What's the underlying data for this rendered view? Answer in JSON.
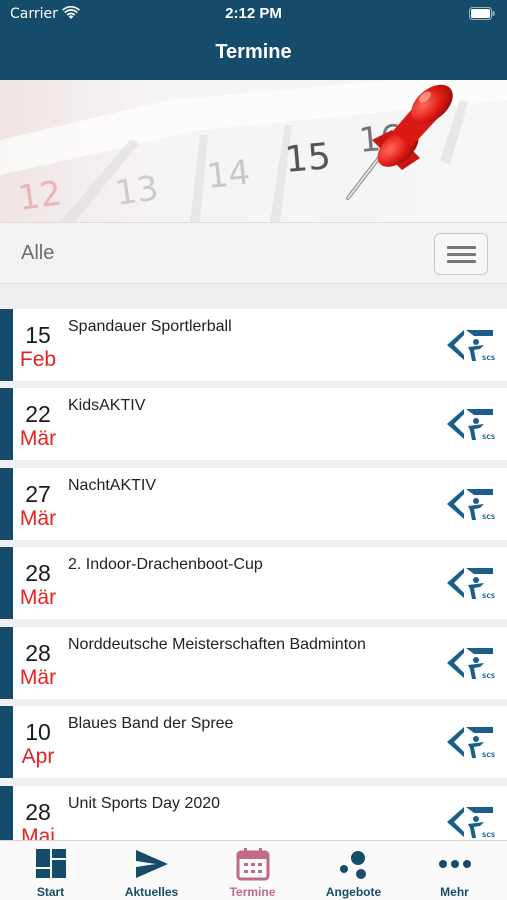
{
  "status_bar": {
    "carrier": "Carrier",
    "time": "2:12 PM"
  },
  "nav": {
    "title": "Termine"
  },
  "banner": {
    "calendar_numbers": [
      "12",
      "13",
      "14",
      "15",
      "16"
    ]
  },
  "filter": {
    "label": "Alle"
  },
  "events": [
    {
      "day": "15",
      "month": "Feb",
      "title": "Spandauer Sportlerball"
    },
    {
      "day": "22",
      "month": "Mär",
      "title": "KidsAKTIV"
    },
    {
      "day": "27",
      "month": "Mär",
      "title": "NachtAKTIV"
    },
    {
      "day": "28",
      "month": "Mär",
      "title": "2. Indoor-Drachenboot-Cup"
    },
    {
      "day": "28",
      "month": "Mär",
      "title": "Norddeutsche Meisterschaften Badminton"
    },
    {
      "day": "10",
      "month": "Apr",
      "title": "Blaues Band der Spree"
    },
    {
      "day": "28",
      "month": "Mai",
      "title": "Unit Sports Day 2020"
    }
  ],
  "logo": {
    "text": "SCS"
  },
  "tabs": [
    {
      "label": "Start",
      "icon": "grid-icon"
    },
    {
      "label": "Aktuelles",
      "icon": "send-icon"
    },
    {
      "label": "Termine",
      "icon": "calendar-icon",
      "active": true
    },
    {
      "label": "Angebote",
      "icon": "dots-cluster-icon"
    },
    {
      "label": "Mehr",
      "icon": "more-dots-icon"
    }
  ],
  "colors": {
    "primary": "#164c6b",
    "accent_red": "#e4231f",
    "active_tab": "#c06a85"
  }
}
